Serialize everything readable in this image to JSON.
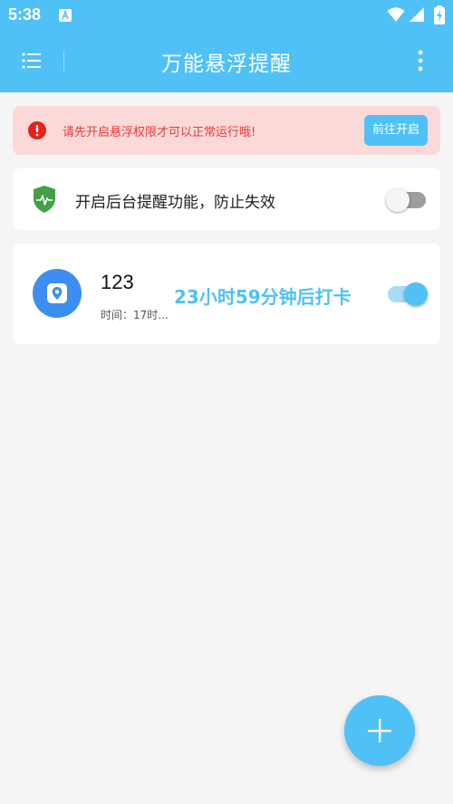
{
  "status_bar": {
    "time": "5:38",
    "icons": [
      "app-notification-icon",
      "wifi-icon",
      "signal-icon",
      "battery-charging-icon"
    ]
  },
  "toolbar": {
    "title": "万能悬浮提醒",
    "left_icon": "menu-icon",
    "right_icon": "more-vert-icon"
  },
  "permission_alert": {
    "message": "请先开启悬浮权限才可以正常运行哦!",
    "button_label": "前往开启",
    "icon": "error-icon"
  },
  "background_reminder": {
    "label": "开启后台提醒功能，防止失效",
    "icon": "shield-heartbeat-icon",
    "enabled": false
  },
  "reminders": [
    {
      "title": "123",
      "time": "时间：17时...",
      "countdown": "23小时59分钟后打卡",
      "icon": "location-icon",
      "enabled": true
    }
  ],
  "fab": {
    "icon": "plus-icon"
  },
  "colors": {
    "primary": "#4fc1f7",
    "alert_background": "#fcd9d9",
    "alert_text": "#e53935",
    "shield": "#43a047",
    "location_badge": "#3d8ef0"
  }
}
